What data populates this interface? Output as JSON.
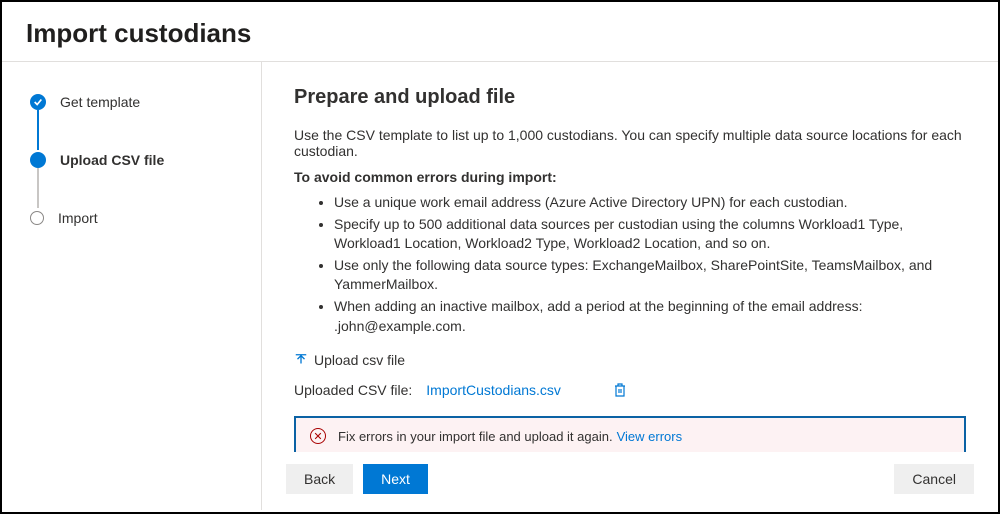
{
  "header": {
    "title": "Import custodians"
  },
  "steps": {
    "items": [
      {
        "label": "Get template",
        "state": "completed"
      },
      {
        "label": "Upload CSV file",
        "state": "active"
      },
      {
        "label": "Import",
        "state": "pending"
      }
    ]
  },
  "main": {
    "heading": "Prepare and upload file",
    "intro": "Use the CSV template to list up to 1,000 custodians. You can specify multiple data source locations for each custodian.",
    "tips_heading": "To avoid common errors during import:",
    "tips": [
      "Use a unique work email address (Azure Active Directory UPN) for each custodian.",
      "Specify up to 500 additional data sources per custodian using the columns Workload1 Type, Workload1 Location, Workload2 Type, Workload2 Location, and so on.",
      "Use only the following data source types: ExchangeMailbox, SharePointSite, TeamsMailbox, and YammerMailbox.",
      "When adding an inactive mailbox, add a period at the beginning of the email address: .john@example.com."
    ],
    "upload_label": "Upload csv file",
    "uploaded_label": "Uploaded CSV file:",
    "uploaded_filename": "ImportCustodians.csv",
    "error_message": "Fix errors in your import file and upload it again.",
    "view_errors_label": "View errors"
  },
  "footer": {
    "back": "Back",
    "next": "Next",
    "cancel": "Cancel"
  }
}
